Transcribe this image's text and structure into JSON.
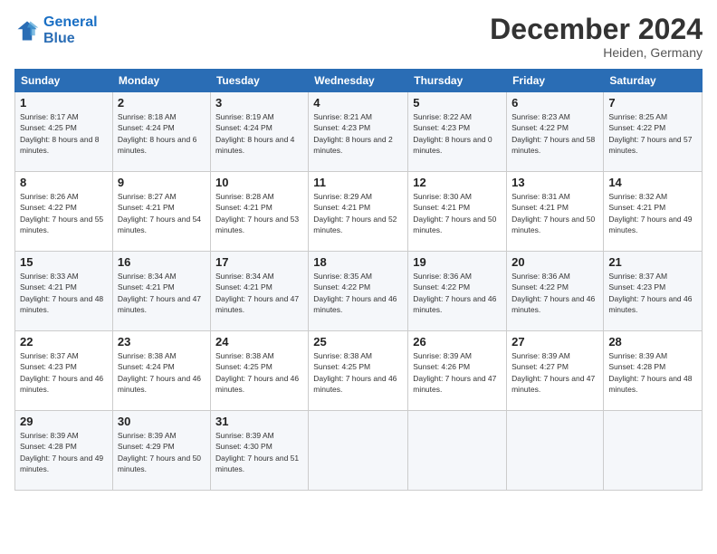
{
  "header": {
    "logo_line1": "General",
    "logo_line2": "Blue",
    "month_title": "December 2024",
    "location": "Heiden, Germany"
  },
  "weekdays": [
    "Sunday",
    "Monday",
    "Tuesday",
    "Wednesday",
    "Thursday",
    "Friday",
    "Saturday"
  ],
  "weeks": [
    [
      {
        "day": "1",
        "sunrise": "Sunrise: 8:17 AM",
        "sunset": "Sunset: 4:25 PM",
        "daylight": "Daylight: 8 hours and 8 minutes."
      },
      {
        "day": "2",
        "sunrise": "Sunrise: 8:18 AM",
        "sunset": "Sunset: 4:24 PM",
        "daylight": "Daylight: 8 hours and 6 minutes."
      },
      {
        "day": "3",
        "sunrise": "Sunrise: 8:19 AM",
        "sunset": "Sunset: 4:24 PM",
        "daylight": "Daylight: 8 hours and 4 minutes."
      },
      {
        "day": "4",
        "sunrise": "Sunrise: 8:21 AM",
        "sunset": "Sunset: 4:23 PM",
        "daylight": "Daylight: 8 hours and 2 minutes."
      },
      {
        "day": "5",
        "sunrise": "Sunrise: 8:22 AM",
        "sunset": "Sunset: 4:23 PM",
        "daylight": "Daylight: 8 hours and 0 minutes."
      },
      {
        "day": "6",
        "sunrise": "Sunrise: 8:23 AM",
        "sunset": "Sunset: 4:22 PM",
        "daylight": "Daylight: 7 hours and 58 minutes."
      },
      {
        "day": "7",
        "sunrise": "Sunrise: 8:25 AM",
        "sunset": "Sunset: 4:22 PM",
        "daylight": "Daylight: 7 hours and 57 minutes."
      }
    ],
    [
      {
        "day": "8",
        "sunrise": "Sunrise: 8:26 AM",
        "sunset": "Sunset: 4:22 PM",
        "daylight": "Daylight: 7 hours and 55 minutes."
      },
      {
        "day": "9",
        "sunrise": "Sunrise: 8:27 AM",
        "sunset": "Sunset: 4:21 PM",
        "daylight": "Daylight: 7 hours and 54 minutes."
      },
      {
        "day": "10",
        "sunrise": "Sunrise: 8:28 AM",
        "sunset": "Sunset: 4:21 PM",
        "daylight": "Daylight: 7 hours and 53 minutes."
      },
      {
        "day": "11",
        "sunrise": "Sunrise: 8:29 AM",
        "sunset": "Sunset: 4:21 PM",
        "daylight": "Daylight: 7 hours and 52 minutes."
      },
      {
        "day": "12",
        "sunrise": "Sunrise: 8:30 AM",
        "sunset": "Sunset: 4:21 PM",
        "daylight": "Daylight: 7 hours and 50 minutes."
      },
      {
        "day": "13",
        "sunrise": "Sunrise: 8:31 AM",
        "sunset": "Sunset: 4:21 PM",
        "daylight": "Daylight: 7 hours and 50 minutes."
      },
      {
        "day": "14",
        "sunrise": "Sunrise: 8:32 AM",
        "sunset": "Sunset: 4:21 PM",
        "daylight": "Daylight: 7 hours and 49 minutes."
      }
    ],
    [
      {
        "day": "15",
        "sunrise": "Sunrise: 8:33 AM",
        "sunset": "Sunset: 4:21 PM",
        "daylight": "Daylight: 7 hours and 48 minutes."
      },
      {
        "day": "16",
        "sunrise": "Sunrise: 8:34 AM",
        "sunset": "Sunset: 4:21 PM",
        "daylight": "Daylight: 7 hours and 47 minutes."
      },
      {
        "day": "17",
        "sunrise": "Sunrise: 8:34 AM",
        "sunset": "Sunset: 4:21 PM",
        "daylight": "Daylight: 7 hours and 47 minutes."
      },
      {
        "day": "18",
        "sunrise": "Sunrise: 8:35 AM",
        "sunset": "Sunset: 4:22 PM",
        "daylight": "Daylight: 7 hours and 46 minutes."
      },
      {
        "day": "19",
        "sunrise": "Sunrise: 8:36 AM",
        "sunset": "Sunset: 4:22 PM",
        "daylight": "Daylight: 7 hours and 46 minutes."
      },
      {
        "day": "20",
        "sunrise": "Sunrise: 8:36 AM",
        "sunset": "Sunset: 4:22 PM",
        "daylight": "Daylight: 7 hours and 46 minutes."
      },
      {
        "day": "21",
        "sunrise": "Sunrise: 8:37 AM",
        "sunset": "Sunset: 4:23 PM",
        "daylight": "Daylight: 7 hours and 46 minutes."
      }
    ],
    [
      {
        "day": "22",
        "sunrise": "Sunrise: 8:37 AM",
        "sunset": "Sunset: 4:23 PM",
        "daylight": "Daylight: 7 hours and 46 minutes."
      },
      {
        "day": "23",
        "sunrise": "Sunrise: 8:38 AM",
        "sunset": "Sunset: 4:24 PM",
        "daylight": "Daylight: 7 hours and 46 minutes."
      },
      {
        "day": "24",
        "sunrise": "Sunrise: 8:38 AM",
        "sunset": "Sunset: 4:25 PM",
        "daylight": "Daylight: 7 hours and 46 minutes."
      },
      {
        "day": "25",
        "sunrise": "Sunrise: 8:38 AM",
        "sunset": "Sunset: 4:25 PM",
        "daylight": "Daylight: 7 hours and 46 minutes."
      },
      {
        "day": "26",
        "sunrise": "Sunrise: 8:39 AM",
        "sunset": "Sunset: 4:26 PM",
        "daylight": "Daylight: 7 hours and 47 minutes."
      },
      {
        "day": "27",
        "sunrise": "Sunrise: 8:39 AM",
        "sunset": "Sunset: 4:27 PM",
        "daylight": "Daylight: 7 hours and 47 minutes."
      },
      {
        "day": "28",
        "sunrise": "Sunrise: 8:39 AM",
        "sunset": "Sunset: 4:28 PM",
        "daylight": "Daylight: 7 hours and 48 minutes."
      }
    ],
    [
      {
        "day": "29",
        "sunrise": "Sunrise: 8:39 AM",
        "sunset": "Sunset: 4:28 PM",
        "daylight": "Daylight: 7 hours and 49 minutes."
      },
      {
        "day": "30",
        "sunrise": "Sunrise: 8:39 AM",
        "sunset": "Sunset: 4:29 PM",
        "daylight": "Daylight: 7 hours and 50 minutes."
      },
      {
        "day": "31",
        "sunrise": "Sunrise: 8:39 AM",
        "sunset": "Sunset: 4:30 PM",
        "daylight": "Daylight: 7 hours and 51 minutes."
      },
      null,
      null,
      null,
      null
    ]
  ]
}
